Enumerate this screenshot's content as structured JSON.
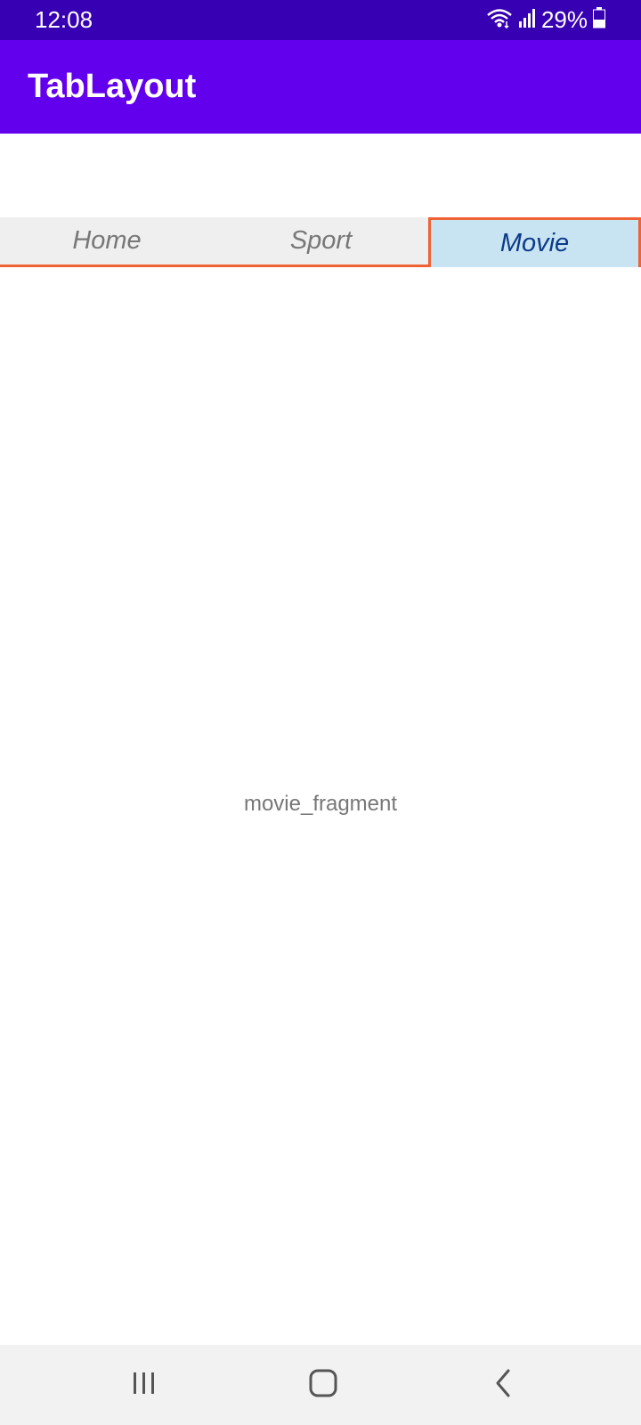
{
  "status_bar": {
    "time": "12:08",
    "battery_percent": "29%",
    "icons": [
      "wifi-icon",
      "signal-icon",
      "battery-icon"
    ]
  },
  "app_bar": {
    "title": "TabLayout",
    "color": "#6200ee"
  },
  "tabs": [
    {
      "label": "Home",
      "selected": false
    },
    {
      "label": "Sport",
      "selected": false
    },
    {
      "label": "Movie",
      "selected": true
    }
  ],
  "content": {
    "text": "movie_fragment"
  },
  "nav_bar": {
    "buttons": [
      "recent-apps-icon",
      "home-icon",
      "back-icon"
    ]
  },
  "colors": {
    "status_bar": "#3700b3",
    "app_bar": "#6200ee",
    "tab_indicator": "#ef6233",
    "selected_tab_bg": "#c8e4f2",
    "selected_tab_text": "#0d3a8a"
  }
}
